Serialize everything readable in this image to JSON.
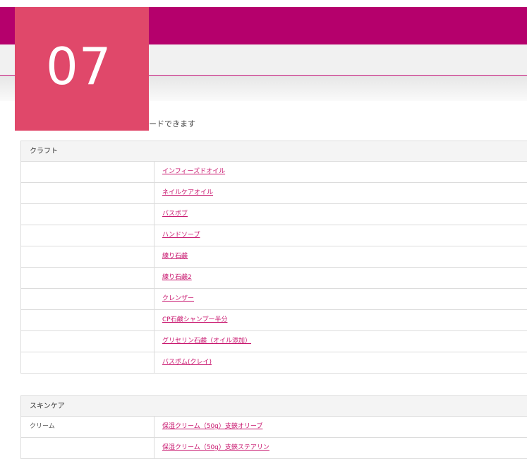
{
  "badge": {
    "number": "07"
  },
  "caption": "ードできます",
  "sections": [
    {
      "title": "クラフト",
      "rows": [
        {
          "label": "",
          "link": "インフィーズドオイル"
        },
        {
          "label": "",
          "link": "ネイルケアオイル"
        },
        {
          "label": "",
          "link": "バスボブ"
        },
        {
          "label": "",
          "link": "ハンドソープ"
        },
        {
          "label": "",
          "link": "練り石鹸"
        },
        {
          "label": "",
          "link": "練り石鹸2"
        },
        {
          "label": "",
          "link": "クレンザー"
        },
        {
          "label": "",
          "link": "CP石鹸シャンプー半分"
        },
        {
          "label": "",
          "link": "グリセリン石鹸（オイル添加）"
        },
        {
          "label": "",
          "link": "バスボム(クレイ)"
        }
      ]
    },
    {
      "title": "スキンケア",
      "rows": [
        {
          "label": "クリーム",
          "link": "保湿クリーム（50g）支鋏オリーブ"
        },
        {
          "label": "",
          "link": "保湿クリーム（50g）支鋏ステアリン"
        }
      ]
    }
  ],
  "colors": {
    "brand": "#b5006c",
    "badge": "#e0486a",
    "link": "#c8166e"
  }
}
